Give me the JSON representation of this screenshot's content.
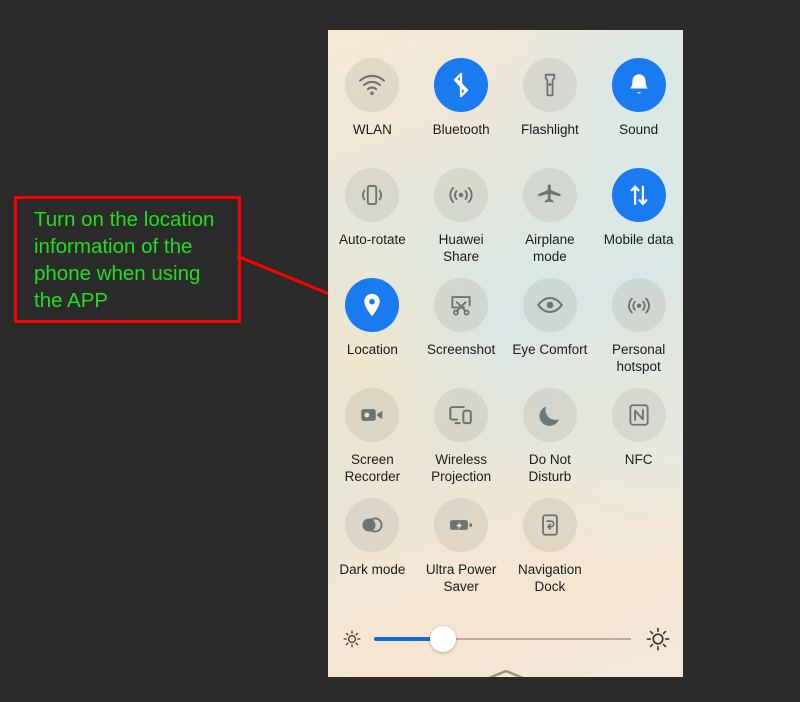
{
  "annotation": {
    "text": "Turn on the location information of the phone when using the APP",
    "box_color": "#ff0000",
    "text_color": "#22dd22",
    "arrow_color": "#ff0000"
  },
  "canvas": {
    "background_color": "#2b2b2b"
  },
  "panel": {
    "name": "control-panel",
    "active_color": "#1a7bf0",
    "inactive_color": "rgba(160,160,150,0.22)",
    "label_color": "#1b1b1b"
  },
  "toggles": [
    {
      "label": "WLAN",
      "icon": "wifi-icon",
      "active": false
    },
    {
      "label": "Bluetooth",
      "icon": "bluetooth-icon",
      "active": true
    },
    {
      "label": "Flashlight",
      "icon": "flashlight-icon",
      "active": false
    },
    {
      "label": "Sound",
      "icon": "bell-icon",
      "active": true
    },
    {
      "label": "Auto-rotate",
      "icon": "auto-rotate-icon",
      "active": false
    },
    {
      "label": "Huawei Share",
      "icon": "huawei-share-icon",
      "active": false
    },
    {
      "label": "Airplane mode",
      "icon": "airplane-icon",
      "active": false
    },
    {
      "label": "Mobile data",
      "icon": "mobile-data-icon",
      "active": true
    },
    {
      "label": "Location",
      "icon": "location-pin-icon",
      "active": true
    },
    {
      "label": "Screenshot",
      "icon": "screenshot-scissors-icon",
      "active": false
    },
    {
      "label": "Eye Comfort",
      "icon": "eye-icon",
      "active": false
    },
    {
      "label": "Personal hotspot",
      "icon": "hotspot-icon",
      "active": false
    },
    {
      "label": "Screen Recorder",
      "icon": "video-camera-icon",
      "active": false
    },
    {
      "label": "Wireless Projection",
      "icon": "cast-screen-icon",
      "active": false
    },
    {
      "label": "Do Not Disturb",
      "icon": "moon-icon",
      "active": false
    },
    {
      "label": "NFC",
      "icon": "nfc-icon",
      "active": false
    },
    {
      "label": "Dark mode",
      "icon": "dark-mode-circles-icon",
      "active": false
    },
    {
      "label": "Ultra Power Saver",
      "icon": "battery-bolt-icon",
      "active": false
    },
    {
      "label": "Navigation Dock",
      "icon": "navigation-dock-icon",
      "active": false
    },
    {
      "label": "",
      "icon": "",
      "active": false
    }
  ],
  "brightness": {
    "value_percent": 27,
    "min_icon": "brightness-low-icon",
    "max_icon": "brightness-high-icon",
    "fill_color": "#1569d6"
  },
  "drag_handle": {
    "icon": "chevron-up-icon"
  }
}
